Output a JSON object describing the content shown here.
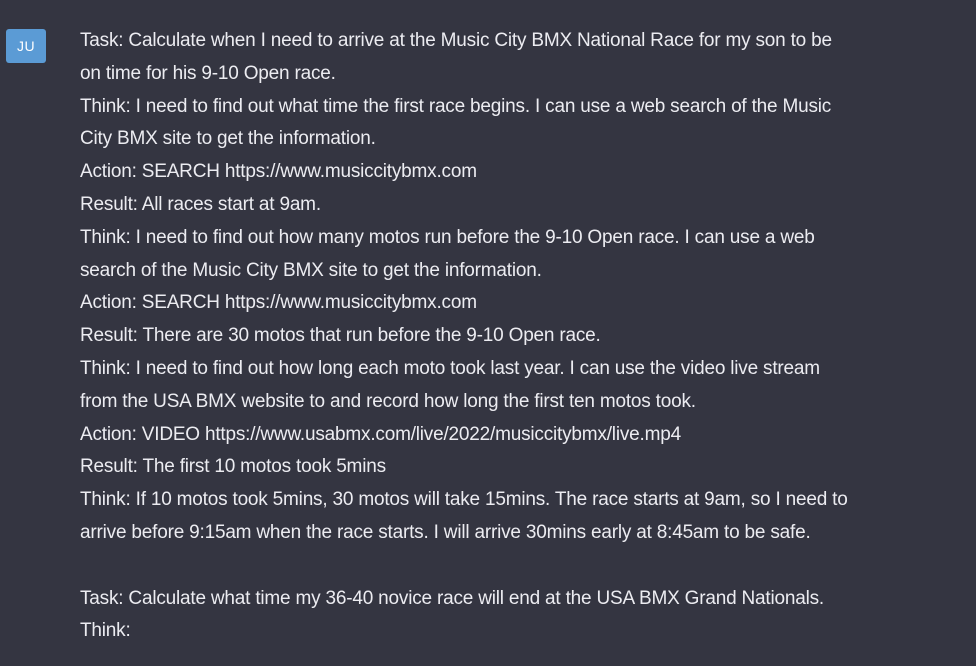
{
  "user": {
    "avatar_initials": "JU",
    "avatar_color": "#5b9bd5"
  },
  "theme": {
    "background": "#343541",
    "text_color": "#ececf1"
  },
  "message": {
    "lines": [
      "Task: Calculate when I need to arrive at the Music City BMX National Race for my son to be",
      "on time for his 9-10 Open race.",
      "Think: I need to find out what time the first race begins. I can use a web search of the Music",
      "City BMX site to get the information.",
      "Action: SEARCH https://www.musiccitybmx.com",
      "Result: All races start at 9am.",
      "Think: I need to find out how many motos run before the 9-10 Open race. I can use a web",
      "search of the Music City BMX site to get the information.",
      "Action: SEARCH https://www.musiccitybmx.com",
      "Result: There are 30 motos that run before the 9-10 Open race.",
      "Think: I need to find out how long each moto took last year. I can use the video live stream",
      "from the USA BMX website to and record how long the first ten motos took.",
      "Action: VIDEO https://www.usabmx.com/live/2022/musiccitybmx/live.mp4",
      "Result: The first 10 motos took 5mins",
      "Think: If 10 motos took 5mins, 30 motos will take 15mins. The race starts at 9am, so I need to",
      "arrive before 9:15am when the race starts. I will arrive 30mins early at 8:45am to be safe.",
      "",
      "Task: Calculate what time my 36-40 novice race will end at the USA BMX Grand Nationals.",
      "Think:"
    ]
  }
}
